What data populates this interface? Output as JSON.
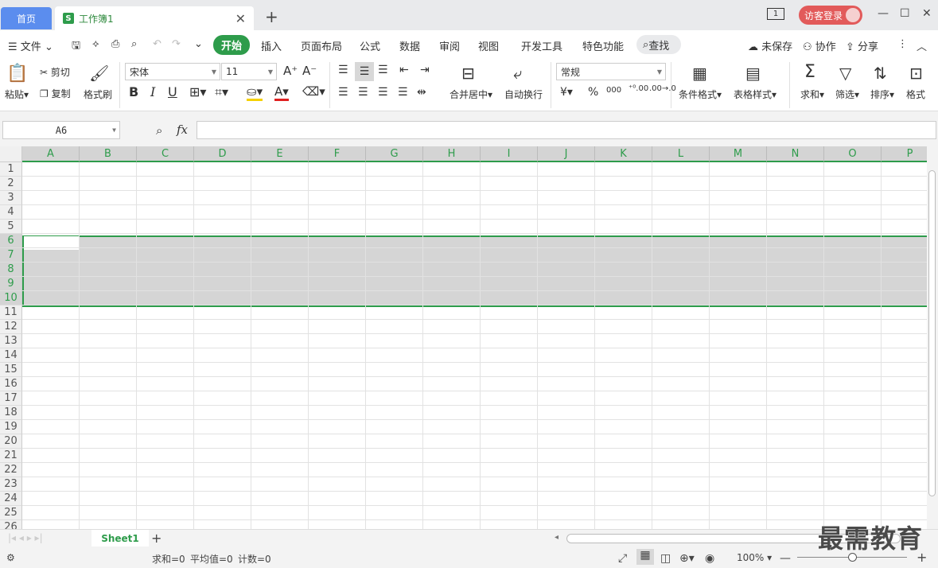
{
  "tabs": {
    "home": "首页",
    "doc": "工作簿1",
    "doc_icon": "S"
  },
  "title_right": {
    "tab_count": "1",
    "visitor": "访客登录"
  },
  "menu": {
    "file": "文件",
    "items": [
      "开始",
      "插入",
      "页面布局",
      "公式",
      "数据",
      "审阅",
      "视图",
      "开发工具",
      "特色功能"
    ],
    "search": "查找",
    "unsaved": "未保存",
    "collab": "协作",
    "share": "分享"
  },
  "ribbon": {
    "paste": "粘贴",
    "cut": "剪切",
    "copy": "复制",
    "format_painter": "格式刷",
    "font_name": "宋体",
    "font_size": "11",
    "merge_center": "合并居中",
    "wrap": "自动换行",
    "number_format": "常规",
    "cond_format": "条件格式",
    "table_style": "表格样式",
    "sum": "求和",
    "filter": "筛选",
    "sort": "排序",
    "format": "格式"
  },
  "formula": {
    "name_box": "A6",
    "fx": "fx",
    "value": ""
  },
  "columns": [
    "A",
    "B",
    "C",
    "D",
    "E",
    "F",
    "G",
    "H",
    "I",
    "J",
    "K",
    "L",
    "M",
    "N",
    "O",
    "P"
  ],
  "rows": [
    "1",
    "2",
    "3",
    "4",
    "5",
    "6",
    "7",
    "8",
    "9",
    "10",
    "11",
    "12",
    "13",
    "14",
    "15",
    "16",
    "17",
    "18",
    "19",
    "20",
    "21",
    "22",
    "23",
    "24",
    "25",
    "26"
  ],
  "sheet": {
    "name": "Sheet1"
  },
  "status": {
    "sum": "求和=0",
    "avg": "平均值=0",
    "count": "计数=0",
    "zoom": "100%"
  },
  "watermark": "最需教育",
  "colors": {
    "accent": "#2e9c4b",
    "home_tab": "#5b8dee",
    "visitor": "#e25a5a"
  }
}
